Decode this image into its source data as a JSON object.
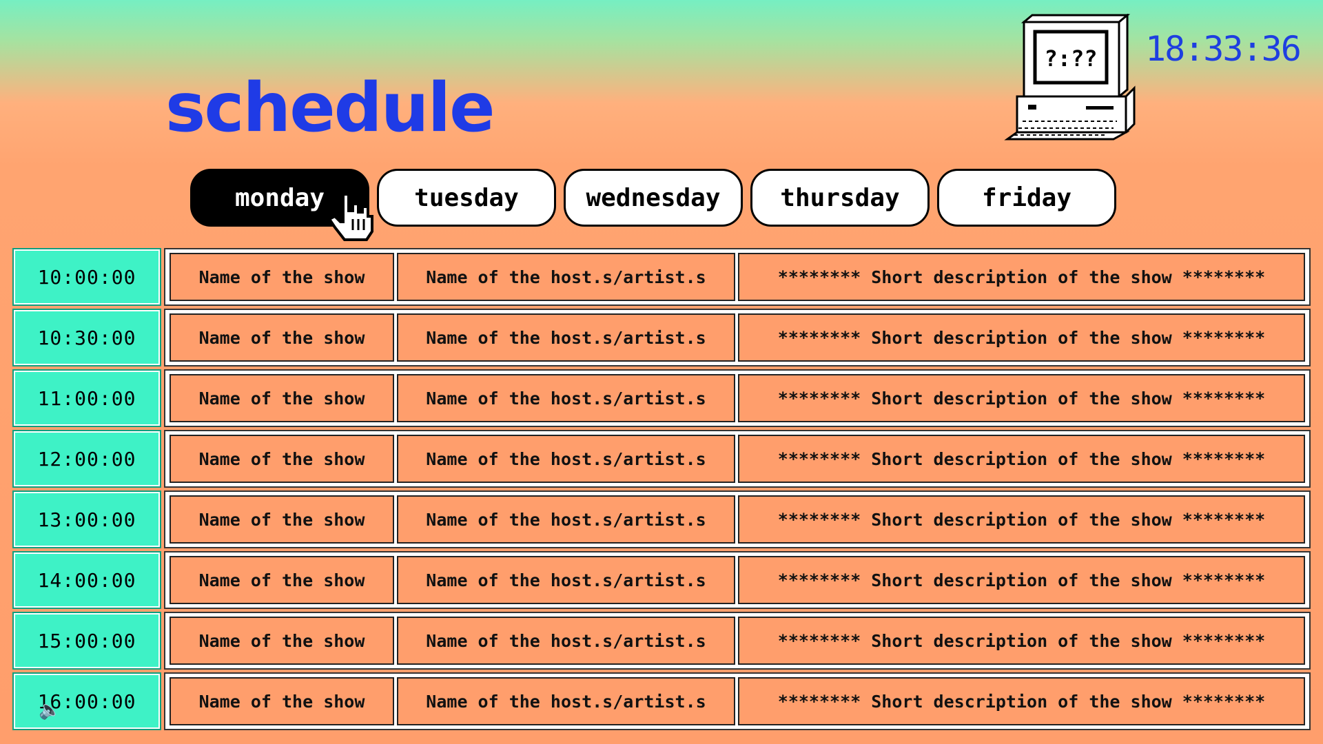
{
  "page": {
    "title": "schedule",
    "clock": "18:33:36",
    "computer_screen_text": "?:??"
  },
  "days": [
    {
      "label": "monday",
      "active": true
    },
    {
      "label": "tuesday",
      "active": false
    },
    {
      "label": "wednesday",
      "active": false
    },
    {
      "label": "thursday",
      "active": false
    },
    {
      "label": "friday",
      "active": false
    }
  ],
  "schedule": [
    {
      "time": "10:00:00",
      "show": "Name of the show",
      "host": "Name of the host.s/artist.s",
      "description": "******** Short description of the show ********"
    },
    {
      "time": "10:30:00",
      "show": "Name of the show",
      "host": "Name of the host.s/artist.s",
      "description": "******** Short description of the show ********"
    },
    {
      "time": "11:00:00",
      "show": "Name of the show",
      "host": "Name of the host.s/artist.s",
      "description": "******** Short description of the show ********"
    },
    {
      "time": "12:00:00",
      "show": "Name of the show",
      "host": "Name of the host.s/artist.s",
      "description": "******** Short description of the show ********"
    },
    {
      "time": "13:00:00",
      "show": "Name of the show",
      "host": "Name of the host.s/artist.s",
      "description": "******** Short description of the show ********"
    },
    {
      "time": "14:00:00",
      "show": "Name of the show",
      "host": "Name of the host.s/artist.s",
      "description": "******** Short description of the show ********"
    },
    {
      "time": "15:00:00",
      "show": "Name of the show",
      "host": "Name of the host.s/artist.s",
      "description": "******** Short description of the show ********"
    },
    {
      "time": "16:00:00",
      "show": "Name of the show",
      "host": "Name of the host.s/artist.s",
      "description": "******** Short description of the show ********"
    }
  ],
  "icons": {
    "computer": "computer-icon",
    "cursor": "pointer-hand-icon",
    "volume": "volume-icon"
  },
  "colors": {
    "title": "#1f3be6",
    "time_cell": "#3ef2c6",
    "show_cell": "#ff9e6c",
    "active_tab": "#000000"
  }
}
